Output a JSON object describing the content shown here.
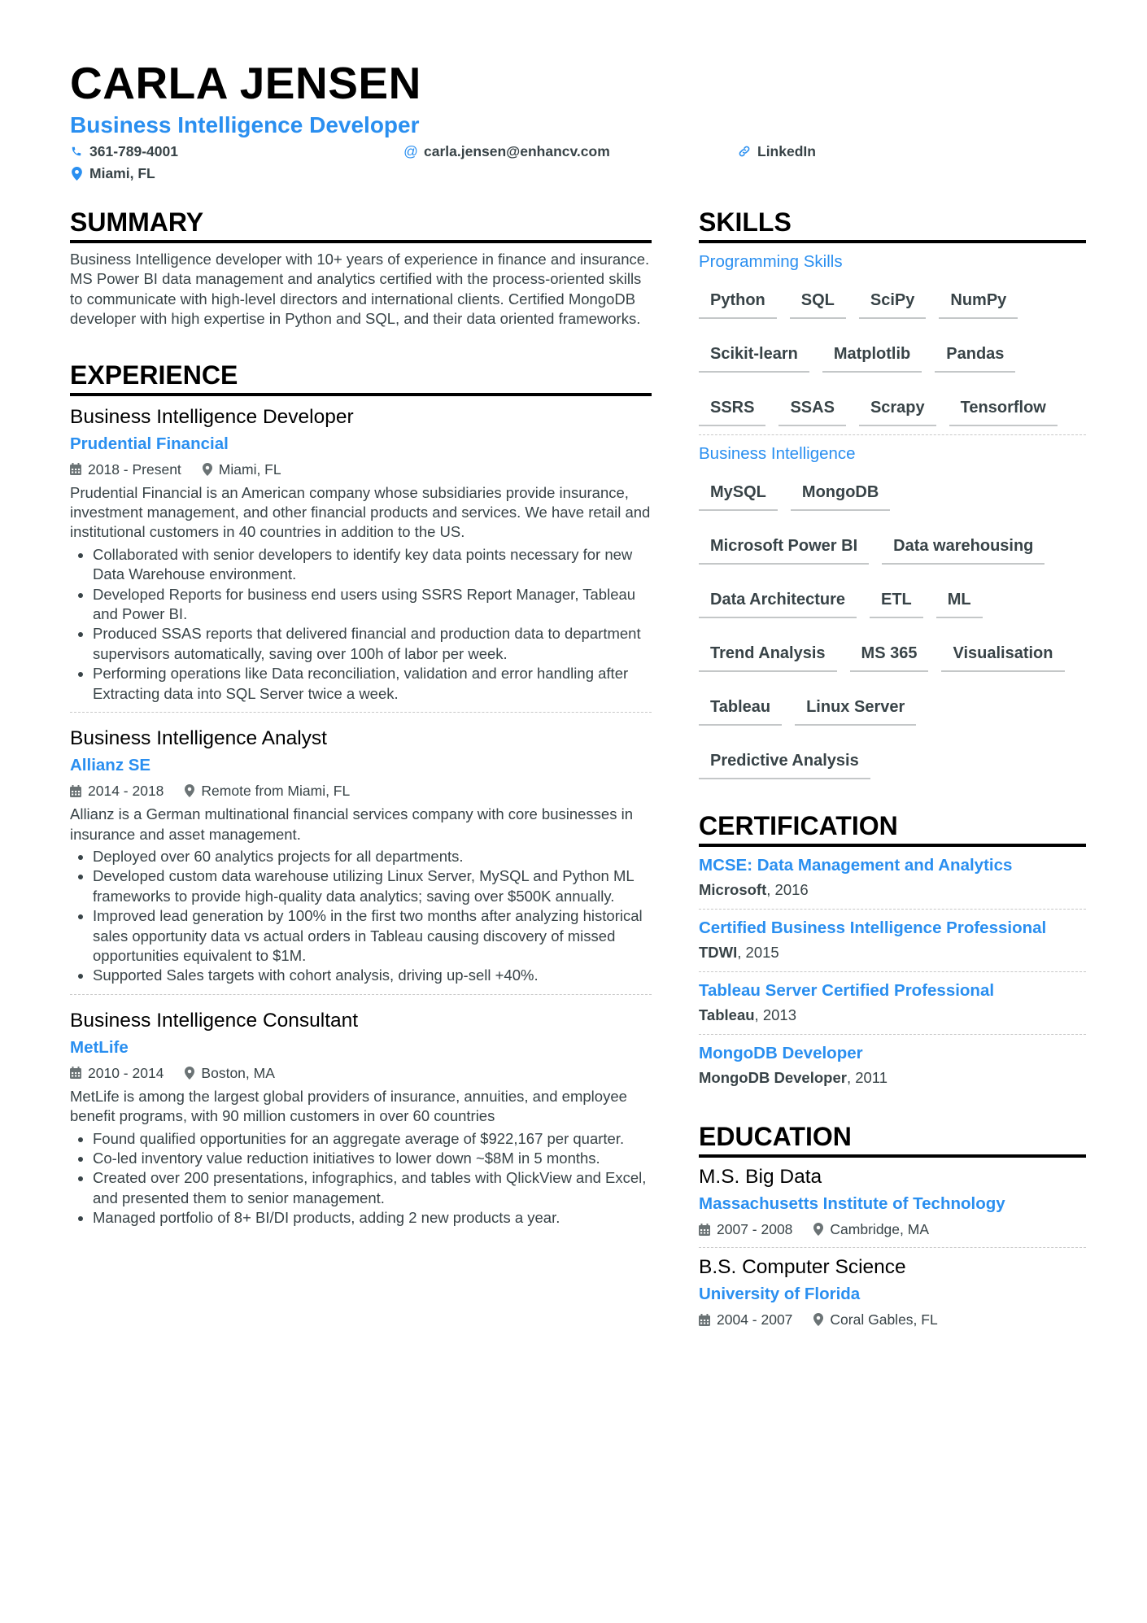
{
  "header": {
    "name": "CARLA JENSEN",
    "title": "Business Intelligence Developer",
    "phone": "361-789-4001",
    "email": "carla.jensen@enhancv.com",
    "linkedin": "LinkedIn",
    "location": "Miami, FL"
  },
  "colors": {
    "accent": "#2a8ff0",
    "text": "#384347",
    "heading": "#000000"
  },
  "summary": {
    "heading": "SUMMARY",
    "text": "Business Intelligence developer with 10+ years of experience in finance and insurance. MS Power BI data management and analytics certified with the process-oriented skills to communicate with high-level directors and international clients. Certified MongoDB developer with high expertise in Python and SQL, and their data oriented frameworks."
  },
  "experience": {
    "heading": "EXPERIENCE",
    "jobs": [
      {
        "title": "Business Intelligence Developer",
        "company": "Prudential Financial",
        "dates": "2018 - Present",
        "location": "Miami, FL",
        "description": "Prudential Financial is an American company whose subsidiaries provide insurance, investment management, and other financial products and services. We have retail and institutional customers in 40 countries in addition to the US.",
        "bullets": [
          "Collaborated with senior developers to identify key data points necessary for new Data Warehouse environment.",
          "Developed Reports for business end users using SSRS Report Manager, Tableau and Power BI.",
          "Produced SSAS reports that delivered financial and production data to department supervisors automatically, saving over 100h of labor per week.",
          "Performing operations like Data reconciliation, validation and error handling after Extracting data into SQL Server twice a week."
        ]
      },
      {
        "title": "Business Intelligence Analyst",
        "company": "Allianz SE",
        "dates": "2014 - 2018",
        "location": "Remote from Miami, FL",
        "description": "Allianz is a German multinational financial services company with core businesses in insurance and asset management.",
        "bullets": [
          "Deployed over 60 analytics projects for all departments.",
          "Developed custom data warehouse utilizing Linux Server, MySQL and Python ML frameworks to provide high-quality data analytics; saving over $500K annually.",
          "Improved lead generation by 100% in the first two months after analyzing historical sales opportunity data vs actual orders in Tableau causing discovery of missed opportunities equivalent to $1M.",
          "Supported Sales targets with cohort analysis, driving up-sell +40%."
        ]
      },
      {
        "title": "Business Intelligence Consultant",
        "company": "MetLife",
        "dates": "2010 - 2014",
        "location": "Boston, MA",
        "description": "MetLife is among the largest global providers of insurance, annuities, and employee benefit programs, with 90 million customers in over 60 countries",
        "bullets": [
          "Found qualified opportunities for an aggregate average of $922,167 per quarter.",
          "Co-led inventory value reduction initiatives to lower down ~$8M in 5 months.",
          "Created over 200 presentations, infographics, and tables with QlickView and Excel, and presented them to senior management.",
          "Managed portfolio of 8+ BI/DI products, adding 2 new products a year."
        ]
      }
    ]
  },
  "skills": {
    "heading": "SKILLS",
    "categories": [
      {
        "name": "Programming Skills",
        "items": [
          "Python",
          "SQL",
          "SciPy",
          "NumPy",
          "Scikit-learn",
          "Matplotlib",
          "Pandas",
          "SSRS",
          "SSAS",
          "Scrapy",
          "Tensorflow"
        ]
      },
      {
        "name": "Business Intelligence",
        "items": [
          "MySQL",
          "MongoDB",
          "Microsoft Power BI",
          "Data warehousing",
          "Data Architecture",
          "ETL",
          "ML",
          "Trend Analysis",
          "MS 365",
          "Visualisation",
          "Tableau",
          "Linux Server",
          "Predictive Analysis"
        ]
      }
    ]
  },
  "certification": {
    "heading": "CERTIFICATION",
    "items": [
      {
        "name": "MCSE: Data Management and Analytics",
        "issuer": "Microsoft",
        "year": ", 2016"
      },
      {
        "name": "Certified Business Intelligence Professional",
        "issuer": "TDWI",
        "year": ", 2015"
      },
      {
        "name": "Tableau Server Certified Professional",
        "issuer": "Tableau",
        "year": ", 2013"
      },
      {
        "name": "MongoDB Developer",
        "issuer": "MongoDB Developer",
        "year": ", 2011"
      }
    ]
  },
  "education": {
    "heading": "EDUCATION",
    "items": [
      {
        "degree": "M.S. Big Data",
        "school": "Massachusetts Institute of Technology",
        "dates": "2007 - 2008",
        "location": "Cambridge, MA"
      },
      {
        "degree": "B.S. Computer Science",
        "school": "University of Florida",
        "dates": "2004 - 2007",
        "location": "Coral Gables, FL"
      }
    ]
  }
}
